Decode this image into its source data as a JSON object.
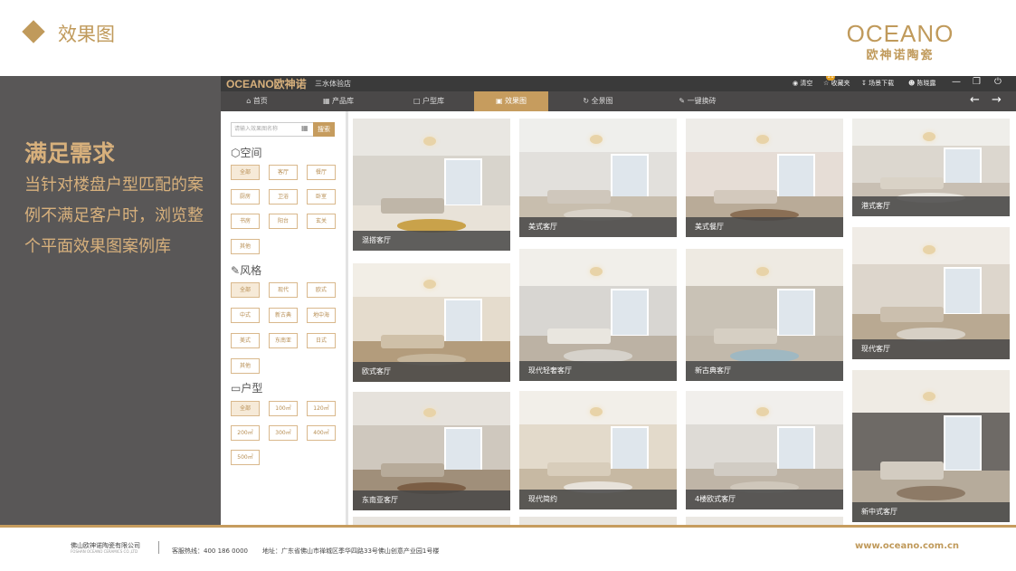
{
  "slide": {
    "title": "效果图",
    "brand_en": "OCEANO",
    "brand_cn": "欧神诺陶瓷"
  },
  "left_panel": {
    "heading": "满足需求",
    "body": "当针对楼盘户型匹配的案例不满足客户时，浏览整个平面效果图案例库"
  },
  "app": {
    "logo": "OCEANO欧神诺",
    "store": "三水体验店",
    "toolbar": [
      {
        "label": "清空",
        "icon": "clear-icon"
      },
      {
        "label": "收藏夹",
        "icon": "favorites-icon",
        "badge": "11"
      },
      {
        "label": "场景下载",
        "icon": "download-icon"
      },
      {
        "label": "陈晓露",
        "icon": "user-icon"
      }
    ],
    "nav": [
      {
        "label": "首页",
        "icon": "home-icon",
        "active": false
      },
      {
        "label": "产品库",
        "icon": "grid-icon",
        "active": false
      },
      {
        "label": "户型库",
        "icon": "floorplan-icon",
        "active": false
      },
      {
        "label": "效果图",
        "icon": "image-icon",
        "active": true
      },
      {
        "label": "全景图",
        "icon": "panorama-icon",
        "active": false
      },
      {
        "label": "一键换砖",
        "icon": "brush-icon",
        "active": false
      }
    ],
    "search_placeholder": "请输入效果图名称",
    "search_button": "搜索",
    "sections": {
      "space": {
        "title": "空间",
        "tags": [
          "全部",
          "客厅",
          "餐厅",
          "厨房",
          "卫浴",
          "卧室",
          "书房",
          "阳台",
          "玄关",
          "其他"
        ]
      },
      "style": {
        "title": "风格",
        "tags": [
          "全部",
          "现代",
          "欧式",
          "中式",
          "新古典",
          "地中海",
          "美式",
          "东南亚",
          "日式",
          "其他"
        ]
      },
      "layout": {
        "title": "户型",
        "tags": [
          "全部",
          "100㎡",
          "120㎡",
          "200㎡",
          "300㎡",
          "400㎡",
          "500㎡"
        ]
      }
    },
    "gallery": [
      {
        "caption": "混搭客厅",
        "colors": [
          "#e9e7e2",
          "#d8d4cc",
          "#bfb6a8",
          "#c9a24a",
          "#e8e2d8"
        ]
      },
      {
        "caption": "美式客厅",
        "colors": [
          "#efefec",
          "#e2e0dc",
          "#cfc7bc",
          "#d9d3c9",
          "#c8beae"
        ]
      },
      {
        "caption": "美式餐厅",
        "colors": [
          "#eeece8",
          "#e6ddd6",
          "#d3c9bd",
          "#8a6f55",
          "#b9ab98"
        ]
      },
      {
        "caption": "港式客厅",
        "colors": [
          "#efeeea",
          "#dcd7cf",
          "#d9d2c6",
          "#e8e5de",
          "#c8bfb3"
        ]
      },
      {
        "caption": "欧式客厅",
        "colors": [
          "#f2eee6",
          "#e5dccd",
          "#cfc0a8",
          "#c6b69c",
          "#b39c7c"
        ]
      },
      {
        "caption": "现代轻奢客厅",
        "colors": [
          "#f1efea",
          "#d8d6d2",
          "#e9e6df",
          "#d6d2cb",
          "#bcb2a4"
        ]
      },
      {
        "caption": "新古典客厅",
        "colors": [
          "#eeeae2",
          "#c9c2b6",
          "#d6cfc3",
          "#9fb8c2",
          "#c2b9ab"
        ]
      },
      {
        "caption": "现代客厅",
        "colors": [
          "#f0ece6",
          "#ddd6cc",
          "#cbbfae",
          "#d7d0c5",
          "#b9a992"
        ]
      },
      {
        "caption": "东南亚客厅",
        "colors": [
          "#e6e2dc",
          "#cfc8be",
          "#b7ab9a",
          "#7b5e45",
          "#a08f7a"
        ]
      },
      {
        "caption": "现代简约",
        "colors": [
          "#f2efe9",
          "#e3dacb",
          "#d8cdbb",
          "#e7e2da",
          "#c7b9a3"
        ]
      },
      {
        "caption": "4楼欧式客厅",
        "colors": [
          "#f1efec",
          "#dedbd6",
          "#d1ccc4",
          "#cfc7bb",
          "#bfb5a7"
        ]
      },
      {
        "caption": "新中式客厅",
        "colors": [
          "#efebe4",
          "#6e6a66",
          "#d3ccc1",
          "#8d7a66",
          "#b6ab9b"
        ]
      }
    ]
  },
  "footer": {
    "company": "佛山欧神诺陶瓷有限公司",
    "company_en": "FOSHAN OCEANO CERAMICS CO.,LTD",
    "hotline": "客服热线：400 186 0000",
    "address": "地址：广东省佛山市禅城区季华四路33号佛山创意产业园1号楼",
    "website": "www.oceano.com.cn"
  }
}
